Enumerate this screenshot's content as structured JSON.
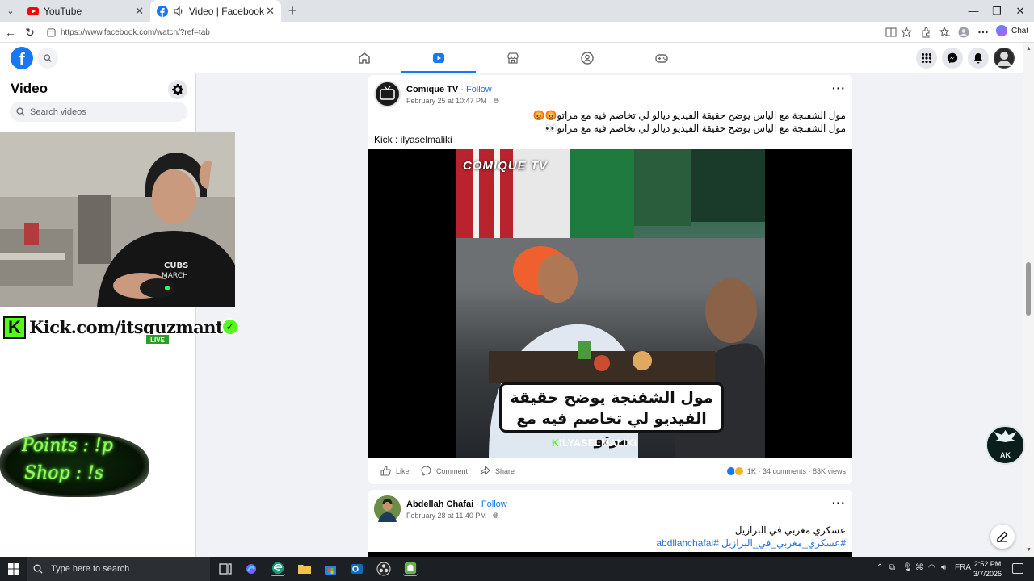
{
  "browser": {
    "tabs": [
      {
        "title": "YouTube",
        "active": false,
        "icon": "youtube-icon"
      },
      {
        "title": "Video | Facebook",
        "active": true,
        "icon": "facebook-icon",
        "muted_icon": "speaker-icon"
      }
    ],
    "url": "https://www.facebook.com/watch/?ref=tab",
    "chat_label": "Chat"
  },
  "fb": {
    "nav_tabs": [
      "home-icon",
      "watch-icon",
      "marketplace-icon",
      "groups-icon",
      "gaming-icon"
    ],
    "active_tab": "watch-icon",
    "logo_letter": "f",
    "right_buttons": [
      "menu-grid-icon",
      "messenger-icon",
      "notifications-icon",
      "profile-avatar"
    ]
  },
  "sidebar": {
    "title": "Video",
    "search_placeholder": "Search videos"
  },
  "overlay": {
    "kick_letter": "K",
    "kick_url": "Kick.com/itsguzmantv",
    "live_label": "LIVE",
    "points": "Points : !p",
    "shop": "Shop : !s",
    "ak_badge": "AK"
  },
  "posts": [
    {
      "author": "Comique TV",
      "follow_label": "Follow",
      "date": "February 25 at 10:47 PM",
      "privacy_icon": "globe-icon",
      "text_line1": "مول الشفنجة مع الياس يوضح حقيقة الفيديو ديالو لي تخاصم فيه مع مراتو😡😡",
      "text_line2": "مول الشفنجة مع الياس يوضح حقيقة الفيديو  ديالو لي تخاصم فيه مع مراتو👀",
      "text_line3": "Kick : ilyaselmaliki",
      "video_watermark": "COMIQUE TV",
      "video_caption_line1": "مول الشفنجة يوضح حقيقة",
      "video_caption_line2": "الفيديو لي تخاصم فيه مع مرتو",
      "video_handle_k": "K",
      "video_handle": "ILYASELMALIKI",
      "actions": {
        "like": "Like",
        "comment": "Comment",
        "share": "Share"
      },
      "reactions_count": "1K",
      "comments": "34 comments",
      "views": "83K views"
    },
    {
      "author": "Abdellah Chafai",
      "follow_label": "Follow",
      "date": "February 28 at 11:40 PM",
      "privacy_icon": "globe-icon",
      "text_line1": "عسكري مغربي في البرازيل",
      "hashtags": "#عسكري_مغربي_في_البرازيل #abdllahchafai"
    }
  ],
  "taskbar": {
    "search_placeholder": "Type here to search",
    "language": "FRA",
    "time": "2:52 PM",
    "date": "3/7/2026"
  },
  "colors": {
    "fb_blue": "#1877f2",
    "kick_green": "#53fc18"
  }
}
